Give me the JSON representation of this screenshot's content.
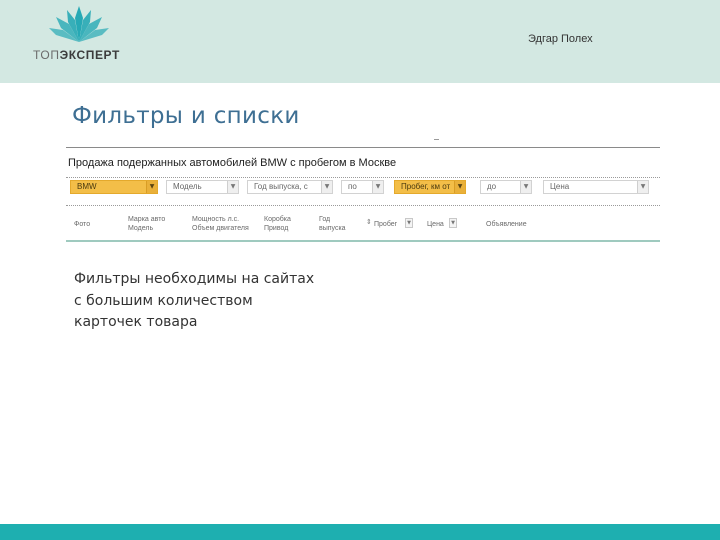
{
  "header": {
    "logo_text_thin": "ТОП",
    "logo_text_bold": "ЭКСПЕРТ",
    "author": "Эдгар Полех"
  },
  "slide": {
    "title": "Фильтры и списки",
    "body_lines": [
      "Фильтры необходимы на сайтах",
      "с большим количеством",
      "карточек товара"
    ]
  },
  "screenshot": {
    "title": "Продажа подержанных автомобилей BMW с пробегом в Москве",
    "filters": [
      {
        "label": "BMW",
        "highlighted": true
      },
      {
        "label": "Модель",
        "highlighted": false
      },
      {
        "label": "Год выпуска, с",
        "highlighted": false
      },
      {
        "label": "по",
        "highlighted": false
      },
      {
        "label": "Пробег, км от",
        "highlighted": true
      },
      {
        "label": "до",
        "highlighted": false
      },
      {
        "label": "Цена",
        "highlighted": false
      }
    ],
    "columns": [
      "Фото",
      "Марка авто\nМодель",
      "Мощность л.с.\nОбъем двигателя",
      "Коробка\nПривод",
      "Год\nвыпуска",
      "Пробег",
      "Цена",
      "Объявление"
    ]
  },
  "colors": {
    "header_band": "#d3e8e2",
    "title": "#3e6f93",
    "filter_highlight": "#f3be48",
    "footer_band": "#1eafb0",
    "logo_mark": "#27a9b5"
  }
}
